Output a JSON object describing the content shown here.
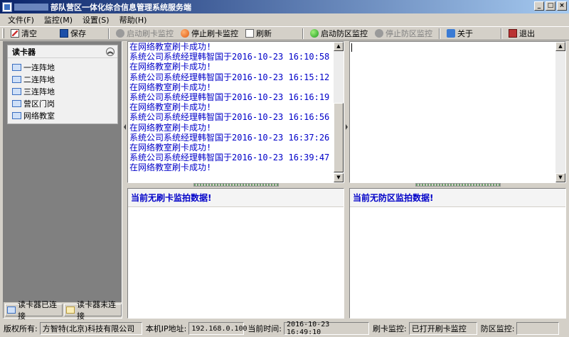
{
  "window": {
    "title": "部队营区一体化综合信息管理系统服务端",
    "controls": [
      "_",
      "□",
      "×"
    ]
  },
  "menu": [
    "文件(F)",
    "监控(M)",
    "设置(S)",
    "帮助(H)"
  ],
  "toolbar": {
    "clear": "清空",
    "save": "保存",
    "start_card_monitor": "启动刷卡监控",
    "stop_card_monitor": "停止刷卡监控",
    "refresh": "刷新",
    "start_zone_monitor": "启动防区监控",
    "stop_zone_monitor": "停止防区监控",
    "about": "关于",
    "exit": "退出"
  },
  "readers": {
    "title": "读卡器",
    "collapse_icon": "chevron-double-up-icon",
    "items": [
      "一连阵地",
      "二连阵地",
      "三连阵地",
      "营区门岗",
      "网络教室"
    ]
  },
  "legend": {
    "connected": "读卡器已连接",
    "disconnected": "读卡器未连接"
  },
  "card_log": [
    "在网络教室刷卡成功!",
    "系统公司系统经理韩智国于2016-10-23 16:10:58",
    "在网络教室刷卡成功!",
    "系统公司系统经理韩智国于2016-10-23 16:15:12",
    "在网络教室刷卡成功!",
    "系统公司系统经理韩智国于2016-10-23 16:16:19",
    "在网络教室刷卡成功!",
    "系统公司系统经理韩智国于2016-10-23 16:16:56",
    "在网络教室刷卡成功!",
    "系统公司系统经理韩智国于2016-10-23 16:37:26",
    "在网络教室刷卡成功!",
    "系统公司系统经理韩智国于2016-10-23 16:39:47",
    "在网络教室刷卡成功!"
  ],
  "card_status": "当前无刷卡监拍数据!",
  "zone_status": "当前无防区监拍数据!",
  "statusbar": {
    "copyright_label": "版权所有:",
    "copyright_value": "方智特(北京)科技有限公司",
    "ip_label": "本机IP地址:",
    "ip_value": "192.168.0.100",
    "time_label": "当前时间:",
    "time_value": "2016-10-23 16:49:10",
    "card_monitor_label": "刷卡监控:",
    "card_monitor_value": "已打开刷卡监控",
    "zone_monitor_label": "防区监控:",
    "zone_monitor_value": ""
  }
}
